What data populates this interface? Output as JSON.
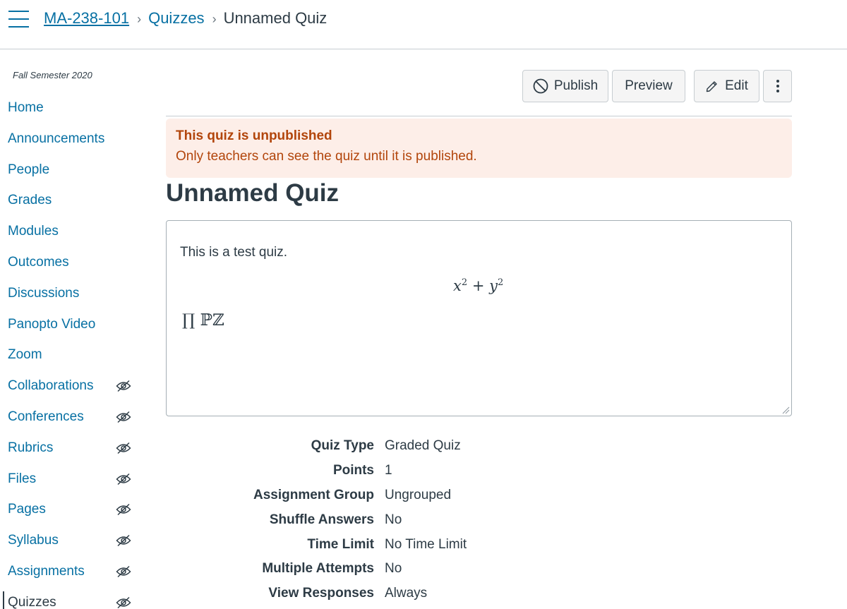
{
  "header": {
    "breadcrumbs": [
      {
        "label": "MA-238-101"
      },
      {
        "label": "Quizzes"
      },
      {
        "label": "Unnamed Quiz"
      }
    ]
  },
  "sidebar": {
    "term": "Fall Semester 2020",
    "items": [
      {
        "label": "Home",
        "hidden_icon": false
      },
      {
        "label": "Announcements",
        "hidden_icon": false
      },
      {
        "label": "People",
        "hidden_icon": false
      },
      {
        "label": "Grades",
        "hidden_icon": false
      },
      {
        "label": "Modules",
        "hidden_icon": false
      },
      {
        "label": "Outcomes",
        "hidden_icon": false
      },
      {
        "label": "Discussions",
        "hidden_icon": false
      },
      {
        "label": "Panopto Video",
        "hidden_icon": false
      },
      {
        "label": "Zoom",
        "hidden_icon": false
      },
      {
        "label": "Collaborations",
        "hidden_icon": true
      },
      {
        "label": "Conferences",
        "hidden_icon": true
      },
      {
        "label": "Rubrics",
        "hidden_icon": true
      },
      {
        "label": "Files",
        "hidden_icon": true
      },
      {
        "label": "Pages",
        "hidden_icon": true
      },
      {
        "label": "Syllabus",
        "hidden_icon": true
      },
      {
        "label": "Assignments",
        "hidden_icon": true
      },
      {
        "label": "Quizzes",
        "hidden_icon": true,
        "active": true
      }
    ]
  },
  "toolbar": {
    "publish_label": "Publish",
    "preview_label": "Preview",
    "edit_label": "Edit"
  },
  "alert": {
    "title": "This quiz is unpublished",
    "message": "Only teachers can see the quiz until it is published."
  },
  "quiz": {
    "title": "Unnamed Quiz",
    "description": "This is a test quiz.",
    "math_x": "x",
    "math_y": "y",
    "math_exp": "2",
    "math_plus": "+",
    "symbols": "∏ ℙℤ",
    "details": [
      {
        "key": "Quiz Type",
        "value": "Graded Quiz"
      },
      {
        "key": "Points",
        "value": "1"
      },
      {
        "key": "Assignment Group",
        "value": "Ungrouped"
      },
      {
        "key": "Shuffle Answers",
        "value": "No"
      },
      {
        "key": "Time Limit",
        "value": "No Time Limit"
      },
      {
        "key": "Multiple Attempts",
        "value": "No"
      },
      {
        "key": "View Responses",
        "value": "Always"
      }
    ]
  },
  "colors": {
    "link": "#0770a3",
    "text": "#2d3b45",
    "alert_bg": "#fdeee8",
    "alert_text": "#b2450b"
  }
}
